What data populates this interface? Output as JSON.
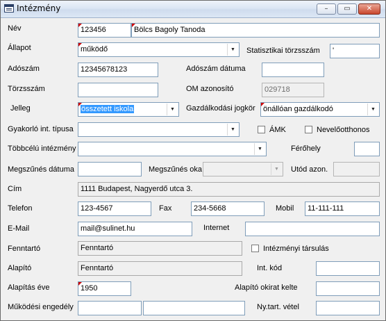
{
  "window": {
    "title": "Intézmény",
    "minimize": "–",
    "maximize": "▭",
    "close": "✕"
  },
  "form": {
    "nev": {
      "label": "Név",
      "code": "123456",
      "name": "Bölcs Bagoly Tanoda"
    },
    "allapot": {
      "label": "Állapot",
      "value": "működő"
    },
    "stat": {
      "label": "Statisztikai törzsszám",
      "value": "'"
    },
    "adoszam": {
      "label": "Adószám",
      "value": "12345678123"
    },
    "adoszam_datum": {
      "label": "Adószám dátuma",
      "value": ""
    },
    "torzsszam": {
      "label": "Törzsszám",
      "value": ""
    },
    "om": {
      "label": "OM azonosító",
      "value": "029718"
    },
    "jelleg": {
      "label": "Jelleg",
      "value": "összetett iskola"
    },
    "gazd": {
      "label": "Gazdálkodási jogkör",
      "value": "önállóan gazdálkodó"
    },
    "gyakorlo": {
      "label": "Gyakorló int. típusa",
      "value": ""
    },
    "amk": {
      "label": "ÁMK",
      "checked": false
    },
    "nevelo": {
      "label": "Nevelőotthonos",
      "checked": false
    },
    "tobbcelu": {
      "label": "Többcélú intézmény",
      "value": ""
    },
    "ferohely": {
      "label": "Férőhely",
      "value": ""
    },
    "megszunes_datum": {
      "label": "Megszűnés dátuma",
      "value": ""
    },
    "megszunes_ok": {
      "label": "Megszűnés oka",
      "value": ""
    },
    "utod": {
      "label": "Utód azon.",
      "value": ""
    },
    "cim": {
      "label": "Cím",
      "value": "1111 Budapest, Nagyerdő utca 3."
    },
    "telefon": {
      "label": "Telefon",
      "value": "123-4567"
    },
    "fax": {
      "label": "Fax",
      "value": "234-5668"
    },
    "mobil": {
      "label": "Mobil",
      "value": "11-111-111"
    },
    "email": {
      "label": "E-Mail",
      "value": "mail@sulinet.hu"
    },
    "internet": {
      "label": "Internet",
      "value": ""
    },
    "fenntarto": {
      "label": "Fenntartó",
      "value": "Fenntartó"
    },
    "tarsulas": {
      "label": "Intézményi társulás",
      "checked": false
    },
    "alapito": {
      "label": "Alapító",
      "value": "Fenntartó"
    },
    "int_kod": {
      "label": "Int. kód",
      "value": ""
    },
    "alapitas": {
      "label": "Alapítás éve",
      "value": "1950"
    },
    "okirat": {
      "label": "Alapító okirat kelte",
      "value": ""
    },
    "mukodesi": {
      "label": "Működési engedély",
      "value1": "",
      "value2": ""
    },
    "nytart": {
      "label": "Ny.tart. vétel",
      "value": ""
    }
  }
}
